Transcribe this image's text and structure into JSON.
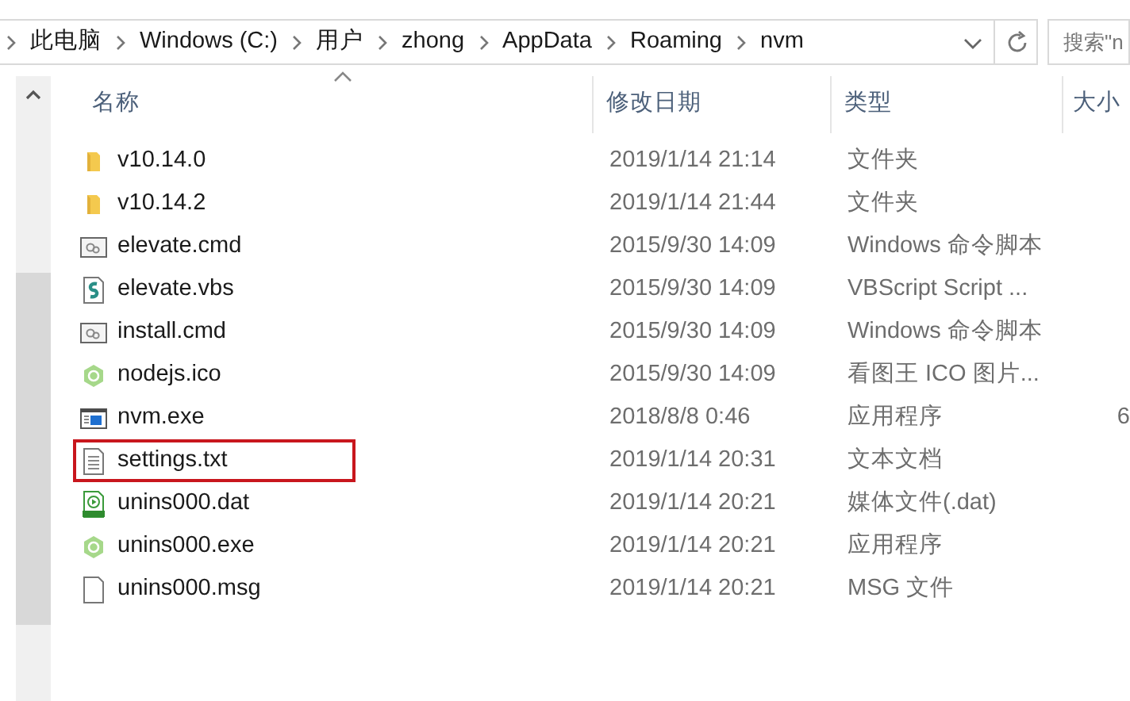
{
  "address_bar": {
    "crumbs": [
      "此电脑",
      "Windows (C:)",
      "用户",
      "zhong",
      "AppData",
      "Roaming",
      "nvm"
    ]
  },
  "search": {
    "placeholder": "搜索\"n"
  },
  "columns": [
    "名称",
    "修改日期",
    "类型",
    "大小"
  ],
  "files": [
    {
      "name": "v10.14.0",
      "date": "2019/1/14 21:14",
      "type": "文件夹",
      "kind": "folder",
      "highlighted": false
    },
    {
      "name": "v10.14.2",
      "date": "2019/1/14 21:44",
      "type": "文件夹",
      "kind": "folder",
      "highlighted": false
    },
    {
      "name": "elevate.cmd",
      "date": "2015/9/30 14:09",
      "type": "Windows 命令脚本",
      "kind": "cmd",
      "highlighted": false
    },
    {
      "name": "elevate.vbs",
      "date": "2015/9/30 14:09",
      "type": "VBScript Script ...",
      "kind": "vbs",
      "highlighted": false
    },
    {
      "name": "install.cmd",
      "date": "2015/9/30 14:09",
      "type": "Windows 命令脚本",
      "kind": "cmd",
      "highlighted": false
    },
    {
      "name": "nodejs.ico",
      "date": "2015/9/30 14:09",
      "type": "看图王 ICO 图片...",
      "kind": "node",
      "highlighted": false
    },
    {
      "name": "nvm.exe",
      "date": "2018/8/8 0:46",
      "type": "应用程序",
      "size": "6",
      "kind": "exe",
      "highlighted": false
    },
    {
      "name": "settings.txt",
      "date": "2019/1/14 20:31",
      "type": "文本文档",
      "kind": "txt",
      "highlighted": true
    },
    {
      "name": "unins000.dat",
      "date": "2019/1/14 20:21",
      "type": "媒体文件(.dat)",
      "kind": "dat",
      "highlighted": false
    },
    {
      "name": "unins000.exe",
      "date": "2019/1/14 20:21",
      "type": "应用程序",
      "kind": "node",
      "highlighted": false
    },
    {
      "name": "unins000.msg",
      "date": "2019/1/14 20:21",
      "type": "MSG 文件",
      "kind": "msg",
      "highlighted": false
    }
  ]
}
